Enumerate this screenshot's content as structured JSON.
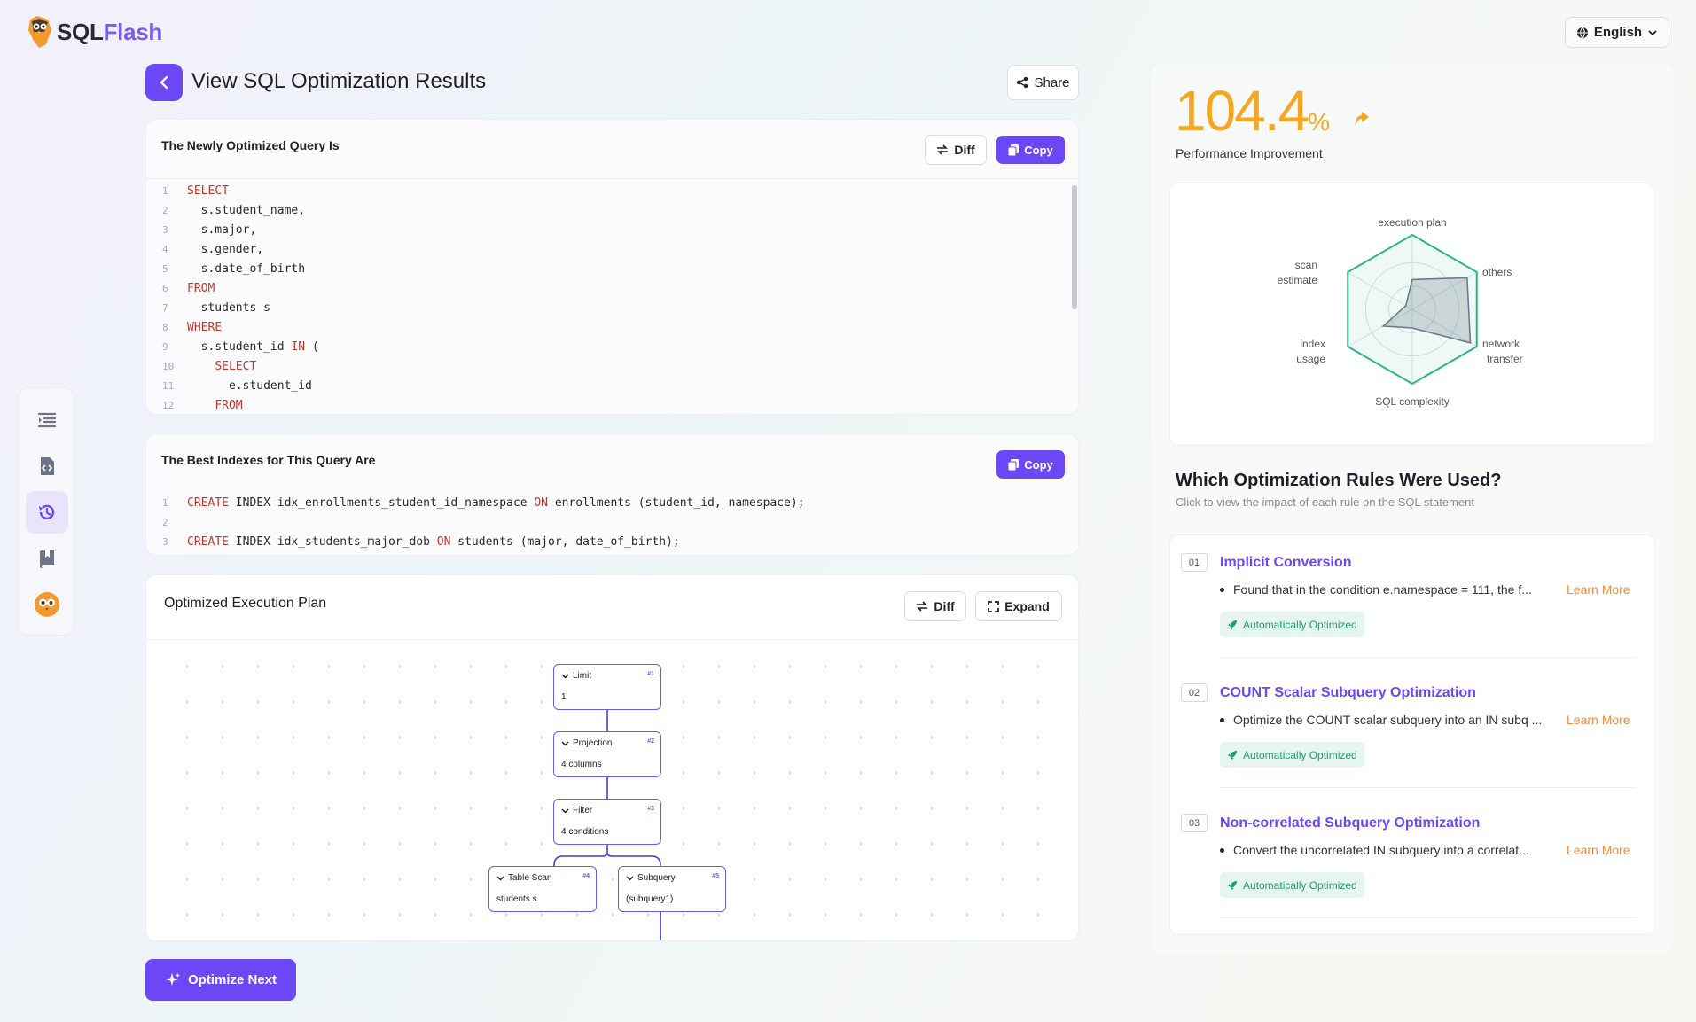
{
  "header": {
    "brand_sql": "SQL",
    "brand_flash": "Flash",
    "language": "English"
  },
  "page": {
    "title": "View SQL Optimization Results",
    "share_label": "Share"
  },
  "optimized_query": {
    "title": "The Newly Optimized Query Is",
    "diff_label": "Diff",
    "copy_label": "Copy",
    "lines": [
      {
        "n": "1",
        "indent": "",
        "kw": "SELECT",
        "rest": ""
      },
      {
        "n": "2",
        "indent": "  ",
        "kw": "",
        "rest": "s.student_name,"
      },
      {
        "n": "3",
        "indent": "  ",
        "kw": "",
        "rest": "s.major,"
      },
      {
        "n": "4",
        "indent": "  ",
        "kw": "",
        "rest": "s.gender,"
      },
      {
        "n": "5",
        "indent": "  ",
        "kw": "",
        "rest": "s.date_of_birth"
      },
      {
        "n": "6",
        "indent": "",
        "kw": "FROM",
        "rest": ""
      },
      {
        "n": "7",
        "indent": "  ",
        "kw": "",
        "rest": "students s"
      },
      {
        "n": "8",
        "indent": "",
        "kw": "WHERE",
        "rest": ""
      },
      {
        "n": "9",
        "indent": "  ",
        "kw": "",
        "rest": "s.student_id ",
        "kw2": "IN",
        "rest2": " ("
      },
      {
        "n": "10",
        "indent": "    ",
        "kw": "SELECT",
        "rest": ""
      },
      {
        "n": "11",
        "indent": "      ",
        "kw": "",
        "rest": "e.student_id"
      },
      {
        "n": "12",
        "indent": "    ",
        "kw": "FROM",
        "rest": ""
      }
    ]
  },
  "indexes": {
    "title": "The Best Indexes for This Query Are",
    "copy_label": "Copy",
    "lines": [
      {
        "n": "1",
        "kw": "CREATE",
        "a": " INDEX idx_enrollments_student_id_namespace ",
        "kw2": "ON",
        "b": " enrollments (student_id, namespace);"
      },
      {
        "n": "2",
        "kw": "",
        "a": "",
        "kw2": "",
        "b": ""
      },
      {
        "n": "3",
        "kw": "CREATE",
        "a": " INDEX idx_students_major_dob ",
        "kw2": "ON",
        "b": " students (major, date_of_birth);"
      }
    ]
  },
  "plan": {
    "title": "Optimized Execution Plan",
    "diff_label": "Diff",
    "expand_label": "Expand",
    "nodes": [
      {
        "name": "Limit",
        "id": "#1",
        "sub": "1"
      },
      {
        "name": "Projection",
        "id": "#2",
        "sub": "4 columns"
      },
      {
        "name": "Filter",
        "id": "#3",
        "sub": "4 conditions"
      },
      {
        "name": "Table Scan",
        "id": "#4",
        "sub": "students s"
      },
      {
        "name": "Subquery",
        "id": "#5",
        "sub": "(subquery1)"
      }
    ]
  },
  "optimize_next_label": "Optimize Next",
  "performance": {
    "value": "104.4",
    "unit": "%",
    "label": "Performance Improvement",
    "accent": "#f5a623"
  },
  "radar": {
    "axes": [
      "execution plan",
      "others",
      "network transfer",
      "SQL complexity",
      "index usage",
      "scan estimate"
    ],
    "labels": {
      "execution_plan": "execution plan",
      "others": "others",
      "network_1": "network",
      "network_2": "transfer",
      "sql_complexity": "SQL complexity",
      "index_1": "index",
      "index_2": "usage",
      "scan_1": "scan",
      "scan_2": "estimate"
    },
    "optimized": [
      1,
      1,
      1,
      1,
      1,
      1
    ],
    "original": [
      0.4,
      0.85,
      0.9,
      0.25,
      0.45,
      0.1
    ],
    "colors": {
      "optimized": "#2bb58a",
      "original": "#6b7a89"
    }
  },
  "rules": {
    "title": "Which Optimization Rules Were Used?",
    "subtitle": "Click to view the impact of each rule on the SQL statement",
    "items": [
      {
        "num": "01",
        "name": "Implicit Conversion",
        "desc": "Found that in the condition e.namespace = 111, the f...",
        "learn": "Learn More",
        "badge": "Automatically Optimized"
      },
      {
        "num": "02",
        "name": "COUNT Scalar Subquery Optimization",
        "desc": "Optimize the COUNT scalar subquery into an IN subq ...",
        "learn": "Learn More",
        "badge": "Automatically Optimized"
      },
      {
        "num": "03",
        "name": "Non-correlated Subquery Optimization",
        "desc": "Convert the uncorrelated IN subquery into a correlat...",
        "learn": "Learn More",
        "badge": "Automatically Optimized"
      }
    ]
  }
}
